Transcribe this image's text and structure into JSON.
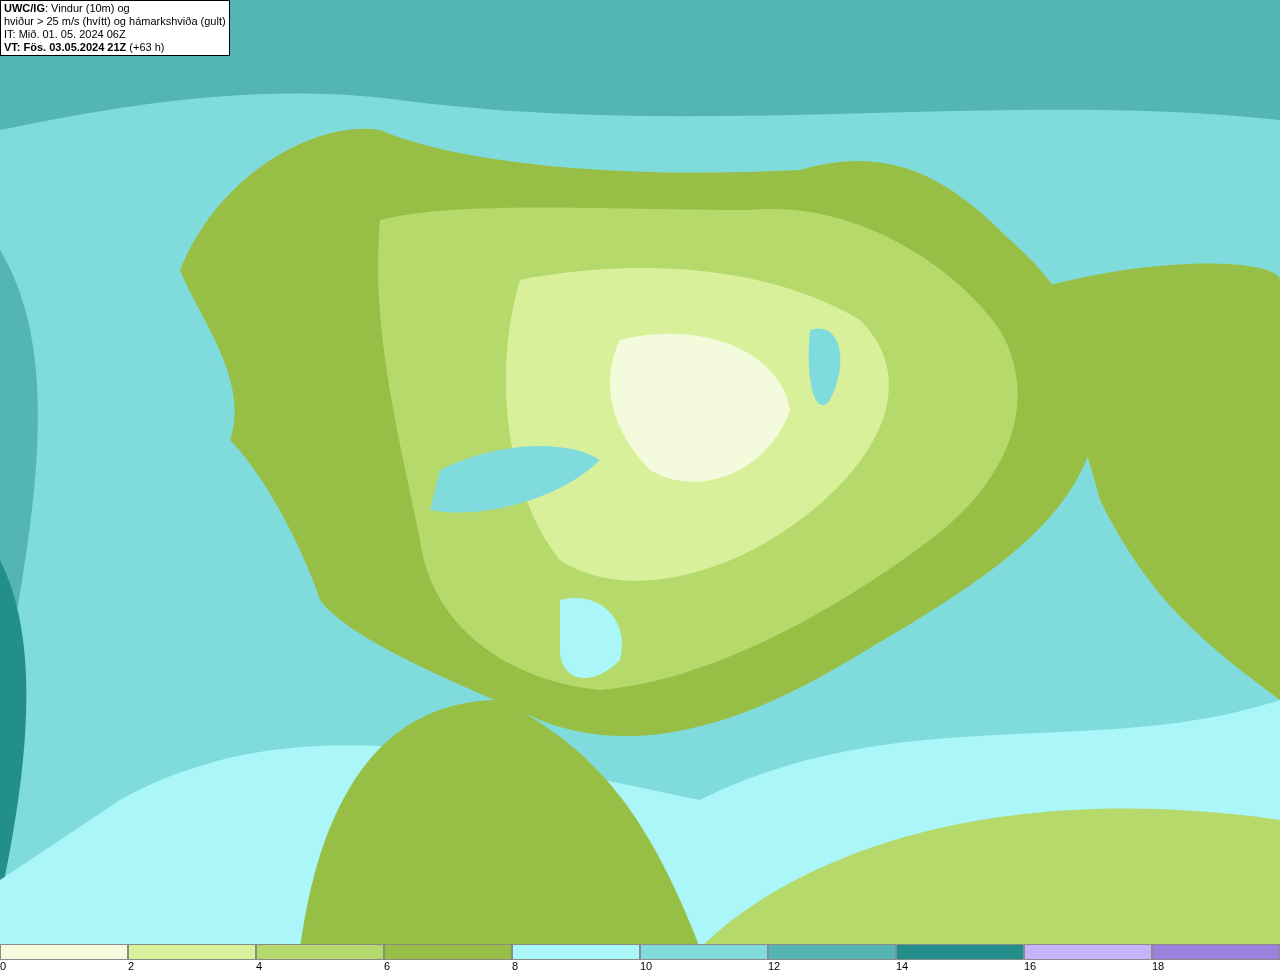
{
  "map": {
    "legend_lines": [
      "**UWC/IG**: Vindur (10m) og",
      "hviður > 25 m/s (hvítt) og hámarkshviða (gult)",
      "IT: Mið. 01. 05. 2024 06Z",
      "**VT: Fös. 03.05.2024 21Z** (+63 h)"
    ]
  },
  "color_scale": [
    {
      "label": "0",
      "color": "#f4fadc"
    },
    {
      "label": "2",
      "color": "#d9f09a"
    },
    {
      "label": "4",
      "color": "#b5d96a"
    },
    {
      "label": "6",
      "color": "#97bf45"
    },
    {
      "label": "8",
      "color": "#aaf6f8"
    },
    {
      "label": "10",
      "color": "#80dcdc"
    },
    {
      "label": "12",
      "color": "#54b5b5"
    },
    {
      "label": "14",
      "color": "#238f8c"
    },
    {
      "label": "16",
      "color": "#c4b4fa"
    },
    {
      "label": "18",
      "color": "#9a82dc"
    }
  ]
}
